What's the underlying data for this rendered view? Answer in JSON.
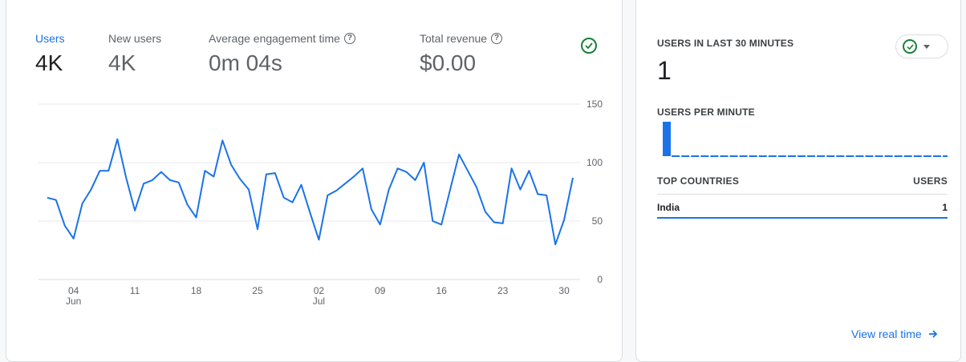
{
  "overview": {
    "metrics": [
      {
        "label": "Users",
        "value": "4K",
        "active": true
      },
      {
        "label": "New users",
        "value": "4K",
        "active": false
      },
      {
        "label": "Average engagement time",
        "value": "0m 04s",
        "active": false,
        "help": true
      },
      {
        "label": "Total revenue",
        "value": "$0.00",
        "active": false,
        "help": true
      }
    ]
  },
  "realtime": {
    "users_last_30_title": "USERS IN LAST 30 MINUTES",
    "users_last_30_value": "1",
    "users_per_minute_title": "USERS PER MINUTE",
    "top_countries_header": "TOP COUNTRIES",
    "users_header": "USERS",
    "countries": [
      {
        "name": "India",
        "users": "1"
      }
    ],
    "view_link": "View real time",
    "users_per_minute": [
      1,
      0,
      0,
      0,
      0,
      0,
      0,
      0,
      0,
      0,
      0,
      0,
      0,
      0,
      0,
      0,
      0,
      0,
      0,
      0,
      0,
      0,
      0,
      0,
      0,
      0,
      0,
      0,
      0,
      0
    ]
  },
  "colors": {
    "accent": "#1a73e8",
    "success": "#188038",
    "grid": "#e8eaed"
  },
  "chart_data": {
    "type": "line",
    "ylim": [
      0,
      150
    ],
    "yticks": [
      0,
      50,
      100,
      150
    ],
    "x_tick_labels": [
      {
        "day": 4,
        "label": "04",
        "sub": "Jun"
      },
      {
        "day": 11,
        "label": "11",
        "sub": ""
      },
      {
        "day": 18,
        "label": "18",
        "sub": ""
      },
      {
        "day": 25,
        "label": "25",
        "sub": ""
      },
      {
        "day": 32,
        "label": "02",
        "sub": "Jul"
      },
      {
        "day": 39,
        "label": "09",
        "sub": ""
      },
      {
        "day": 46,
        "label": "16",
        "sub": ""
      },
      {
        "day": 53,
        "label": "23",
        "sub": ""
      },
      {
        "day": 60,
        "label": "30",
        "sub": ""
      }
    ],
    "series": [
      {
        "x": [
          1,
          2,
          3,
          4,
          5,
          6,
          7,
          8,
          9,
          10,
          11,
          12,
          13,
          14,
          15,
          16,
          17,
          18,
          19,
          20,
          21,
          22,
          23,
          24,
          25,
          26,
          27,
          28,
          29,
          30,
          31,
          32,
          33,
          34,
          35,
          36,
          37,
          38,
          39,
          40,
          41,
          42,
          43,
          44,
          45,
          46,
          47,
          48,
          49,
          50,
          51,
          52,
          53,
          54,
          55,
          56,
          57,
          58,
          59,
          60,
          61
        ],
        "values": [
          70,
          68,
          46,
          35,
          65,
          77,
          93,
          93,
          120,
          87,
          59,
          82,
          85,
          92,
          85,
          83,
          64,
          53,
          93,
          88,
          119,
          98,
          86,
          77,
          43,
          90,
          91,
          70,
          66,
          81,
          57,
          34,
          72,
          76,
          82,
          88,
          95,
          60,
          47,
          77,
          95,
          92,
          85,
          100,
          50,
          47,
          77,
          107,
          93,
          79,
          58,
          49,
          48,
          95,
          77,
          93,
          73,
          72,
          30,
          51,
          87
        ]
      }
    ]
  }
}
